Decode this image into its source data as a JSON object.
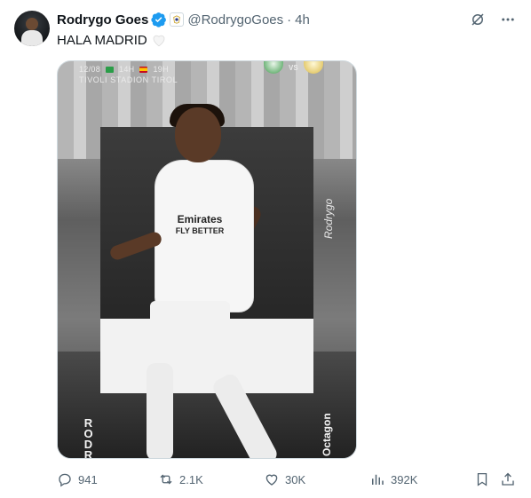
{
  "author": {
    "name": "Rodrygo Goes",
    "handle": "@RodrygoGoes",
    "separator": "·",
    "time": "4h"
  },
  "tweet": {
    "text": "HALA MADRID",
    "emoji_icon": "white-heart-icon"
  },
  "media": {
    "date_line": "12/08",
    "time_br": "14H",
    "time_es": "19H",
    "venue": "TIVOLI STADION TIROL",
    "vs": "VS",
    "sponsor_line1": "Emirates",
    "sponsor_line2": "FLY BETTER",
    "signature": "Rodrygo",
    "brand_vertical": "RODRY",
    "brand_side": "Octagon"
  },
  "actions": {
    "replies": "941",
    "reposts": "2.1K",
    "likes": "30K",
    "views": "392K"
  },
  "colors": {
    "text_primary": "#0f1419",
    "text_secondary": "#536471",
    "verified_blue": "#1d9bf0",
    "border": "#cfd9de"
  }
}
